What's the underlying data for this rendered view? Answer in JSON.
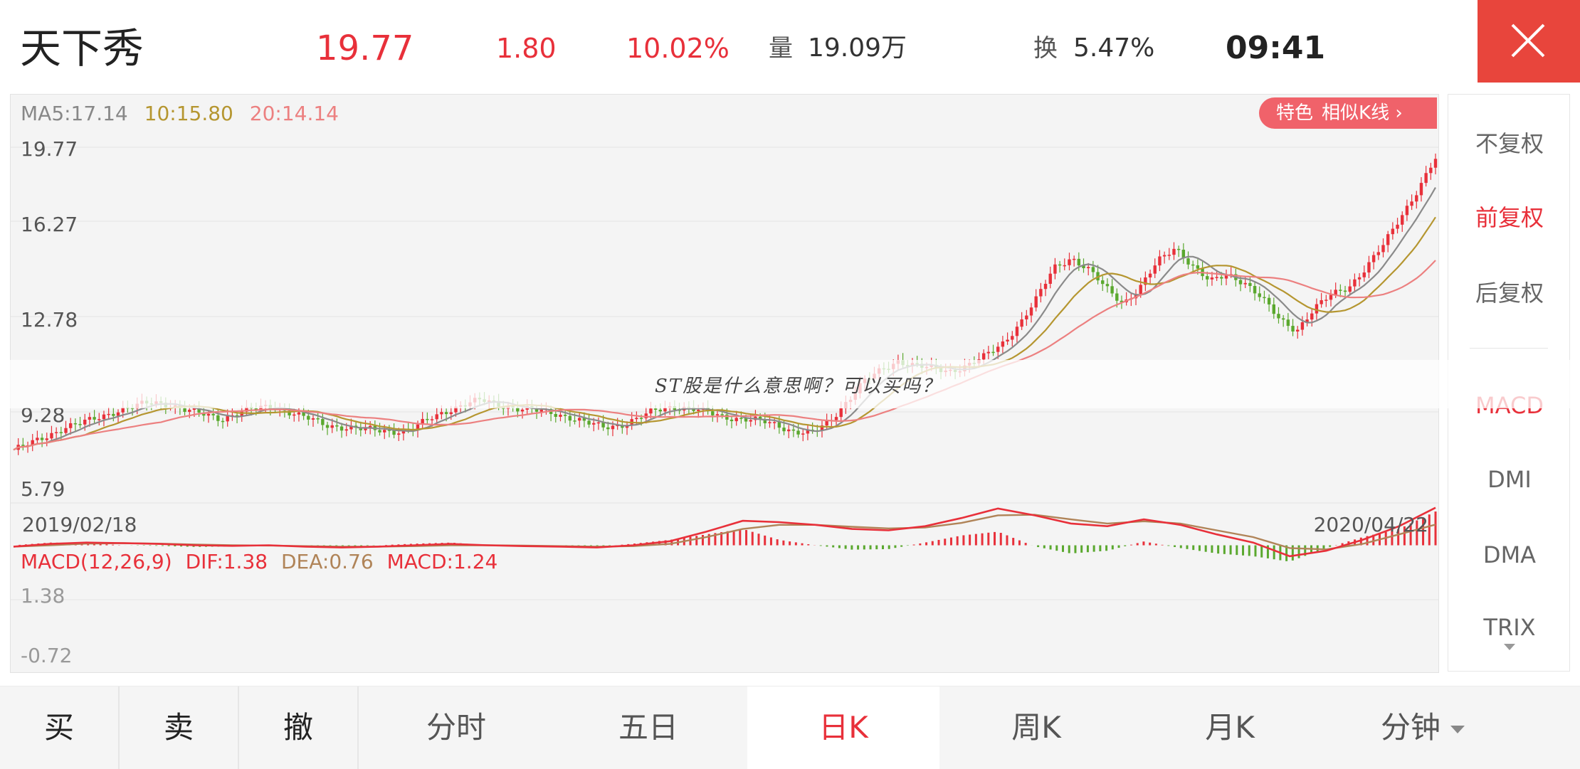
{
  "header": {
    "stock_name": "天下秀",
    "price": "19.77",
    "change": "1.80",
    "change_pct": "10.02%",
    "volume_label": "量",
    "volume_value": "19.09万",
    "turnover_label": "换",
    "turnover_value": "5.47%",
    "clock": "09:41",
    "close_icon": "close-icon"
  },
  "chart": {
    "ma5": "MA5:17.14",
    "ma10": "10:15.80",
    "ma20": "20:14.14",
    "similar_tag": "特色",
    "similar_text": "相似K线 ›",
    "y_ticks": [
      "19.77",
      "16.27",
      "12.78",
      "9.28",
      "5.79"
    ],
    "date_start": "2019/02/18",
    "date_end": "2020/04/22",
    "macd_title": "MACD(12,26,9)",
    "dif": "DIF:1.38",
    "dea": "DEA:0.76",
    "macd": "MACD:1.24",
    "macd_top": "1.38",
    "macd_bottom": "-0.72"
  },
  "chart_data": {
    "type": "line",
    "title": "",
    "xlabel": "",
    "ylabel": "",
    "ylim": [
      4.3,
      21.5
    ],
    "x_range": [
      "2019/02/18",
      "2020/04/22"
    ],
    "colors": {
      "up": "#e8303a",
      "down": "#5aa82e",
      "ma5": "#8a8a8a",
      "ma10": "#b59630",
      "ma20": "#ec8080"
    },
    "close_series": [
      5.7,
      6.0,
      6.4,
      6.8,
      7.0,
      7.3,
      7.6,
      7.8,
      8.0,
      7.9,
      7.6,
      7.4,
      7.2,
      7.5,
      7.7,
      7.8,
      7.5,
      7.2,
      6.9,
      6.8,
      6.7,
      6.65,
      6.6,
      6.7,
      7.2,
      7.6,
      7.9,
      8.1,
      7.9,
      7.7,
      7.6,
      7.5,
      7.3,
      7.0,
      6.8,
      6.9,
      7.2,
      7.6,
      7.8,
      7.7,
      7.5,
      7.3,
      7.2,
      7.1,
      6.9,
      6.6,
      6.5,
      7.0,
      8.0,
      9.0,
      9.5,
      10.0,
      9.8,
      9.6,
      9.5,
      9.8,
      10.2,
      10.8,
      11.8,
      13.0,
      14.5,
      15.0,
      14.4,
      13.5,
      12.8,
      13.6,
      14.8,
      15.5,
      14.6,
      13.8,
      14.2,
      13.8,
      13.0,
      12.0,
      11.5,
      12.5,
      13.2,
      13.6,
      14.5,
      15.6,
      17.0,
      18.3,
      19.77
    ],
    "macd": {
      "dif": [
        -0.05,
        0.05,
        0.1,
        0.08,
        0.05,
        0.0,
        -0.02,
        0.0,
        -0.05,
        -0.08,
        -0.05,
        0.0,
        0.05,
        0.0,
        -0.03,
        -0.05,
        -0.08,
        0.0,
        0.15,
        0.5,
        0.9,
        0.85,
        0.75,
        0.6,
        0.55,
        0.7,
        1.0,
        1.35,
        1.1,
        0.8,
        0.7,
        0.95,
        0.75,
        0.4,
        0.1,
        -0.4,
        -0.2,
        0.2,
        0.7,
        1.38
      ],
      "dea": [
        -0.05,
        0.0,
        0.06,
        0.08,
        0.06,
        0.03,
        0.0,
        -0.01,
        -0.03,
        -0.05,
        -0.05,
        -0.03,
        0.0,
        0.0,
        -0.01,
        -0.03,
        -0.05,
        -0.03,
        0.05,
        0.3,
        0.6,
        0.75,
        0.75,
        0.68,
        0.62,
        0.65,
        0.82,
        1.1,
        1.12,
        0.95,
        0.8,
        0.88,
        0.8,
        0.55,
        0.3,
        -0.1,
        -0.15,
        0.05,
        0.4,
        0.76
      ],
      "histogram": [
        0.0,
        0.1,
        0.08,
        0.0,
        -0.02,
        -0.06,
        -0.04,
        0.02,
        -0.04,
        -0.06,
        0.0,
        0.06,
        0.1,
        0.0,
        -0.04,
        -0.04,
        -0.06,
        0.06,
        0.2,
        0.4,
        0.6,
        0.2,
        0.0,
        -0.16,
        -0.14,
        0.1,
        0.36,
        0.5,
        -0.04,
        -0.3,
        -0.2,
        0.14,
        -0.1,
        -0.3,
        -0.4,
        -0.6,
        -0.1,
        0.3,
        0.6,
        1.24
      ]
    }
  },
  "sidebar": {
    "adj_none": "不复权",
    "adj_fwd": "前复权",
    "adj_back": "后复权",
    "ind_macd": "MACD",
    "ind_dmi": "DMI",
    "ind_dma": "DMA",
    "ind_trix": "TRIX"
  },
  "banner": {
    "text": "ST股是什么意思啊？可以买吗？"
  },
  "bottom": {
    "buy": "买",
    "sell": "卖",
    "cancel": "撤",
    "fenshi": "分时",
    "fiveday": "五日",
    "day": "日K",
    "week": "周K",
    "month": "月K",
    "minute": "分钟"
  }
}
